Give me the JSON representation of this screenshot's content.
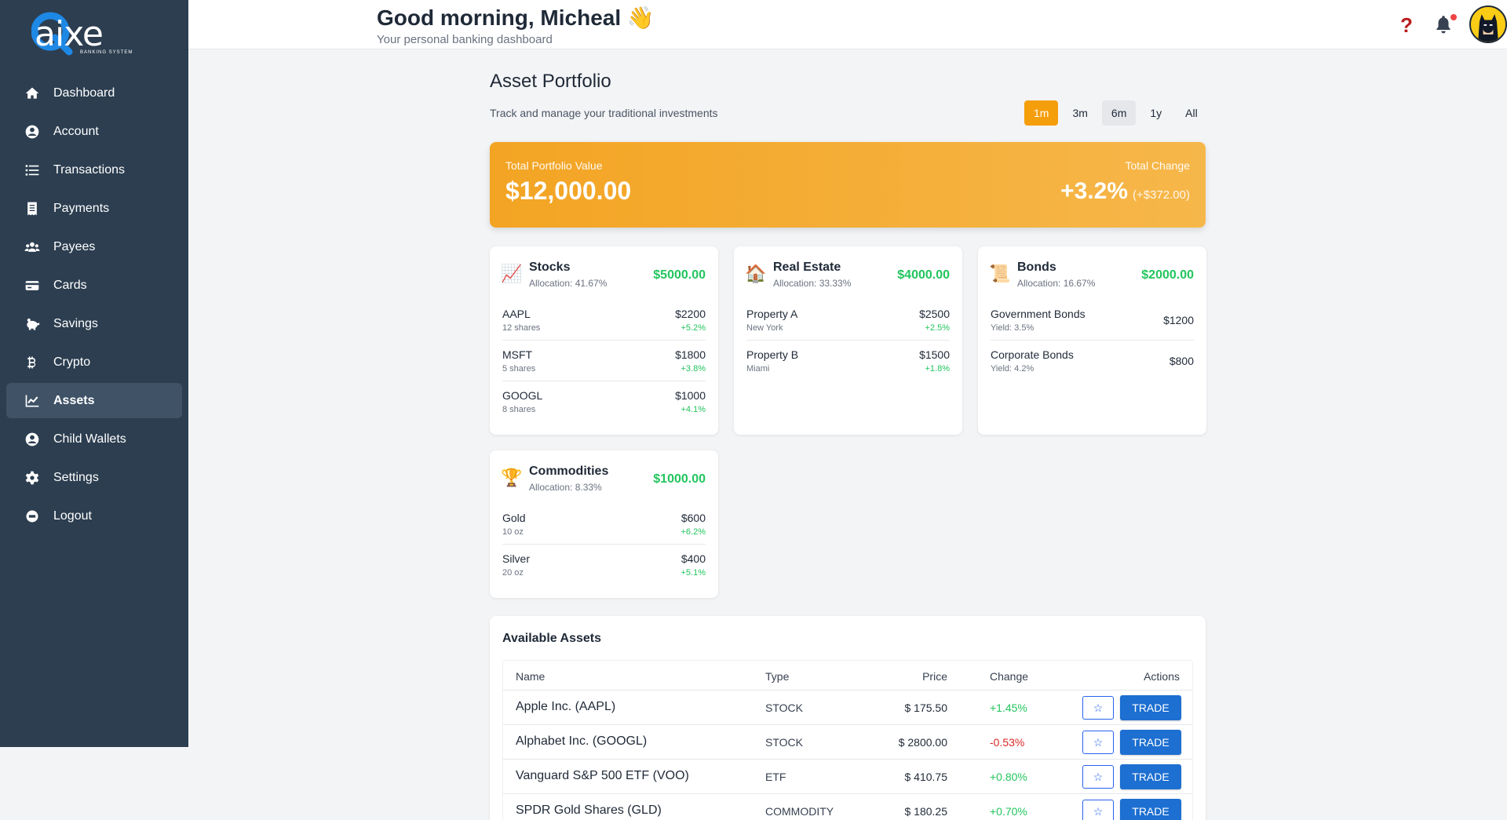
{
  "brand": {
    "logo_text": "aixe",
    "logo_letter": "Q",
    "logo_sub": "BANKING SYSTEM"
  },
  "sidebar": {
    "items": [
      {
        "label": "Dashboard",
        "icon": "home-icon"
      },
      {
        "label": "Account",
        "icon": "user-circle-icon"
      },
      {
        "label": "Transactions",
        "icon": "list-icon"
      },
      {
        "label": "Payments",
        "icon": "receipt-icon"
      },
      {
        "label": "Payees",
        "icon": "users-icon"
      },
      {
        "label": "Cards",
        "icon": "credit-card-icon"
      },
      {
        "label": "Savings",
        "icon": "piggy-bank-icon"
      },
      {
        "label": "Crypto",
        "icon": "bitcoin-icon"
      },
      {
        "label": "Assets",
        "icon": "chart-line-icon",
        "active": true
      },
      {
        "label": "Child Wallets",
        "icon": "user-circle-icon"
      },
      {
        "label": "Settings",
        "icon": "gear-icon"
      },
      {
        "label": "Logout",
        "icon": "logout-icon"
      }
    ]
  },
  "header": {
    "greeting": "Good morning, Micheal",
    "greeting_emoji": "👋",
    "subtitle": "Your personal banking dashboard",
    "help_icon": "question-icon",
    "bell_icon": "bell-icon",
    "avatar": "avatar"
  },
  "main": {
    "title": "Asset Portfolio",
    "subtitle": "Track and manage your traditional investments",
    "ranges": [
      "1m",
      "3m",
      "6m",
      "1y",
      "All"
    ],
    "active_range": "1m",
    "summary": {
      "total_label": "Total Portfolio Value",
      "total_value": "$12,000.00",
      "change_label": "Total Change",
      "change_pct": "+3.2%",
      "change_amt": "(+$372.00)"
    },
    "categories": [
      {
        "title": "Stocks",
        "icon": "📈",
        "allocation": "Allocation: 41.67%",
        "total": "$5000.00",
        "rows": [
          {
            "name": "AAPL",
            "sub": "12 shares",
            "value": "$2200",
            "change": "+5.2%"
          },
          {
            "name": "MSFT",
            "sub": "5 shares",
            "value": "$1800",
            "change": "+3.8%"
          },
          {
            "name": "GOOGL",
            "sub": "8 shares",
            "value": "$1000",
            "change": "+4.1%"
          }
        ]
      },
      {
        "title": "Real Estate",
        "icon": "🏠",
        "allocation": "Allocation: 33.33%",
        "total": "$4000.00",
        "rows": [
          {
            "name": "Property A",
            "sub": "New York",
            "value": "$2500",
            "change": "+2.5%"
          },
          {
            "name": "Property B",
            "sub": "Miami",
            "value": "$1500",
            "change": "+1.8%"
          }
        ]
      },
      {
        "title": "Bonds",
        "icon": "📜",
        "allocation": "Allocation: 16.67%",
        "total": "$2000.00",
        "rows": [
          {
            "name": "Government Bonds",
            "sub": "Yield: 3.5%",
            "value": "$1200",
            "change": ""
          },
          {
            "name": "Corporate Bonds",
            "sub": "Yield: 4.2%",
            "value": "$800",
            "change": ""
          }
        ]
      },
      {
        "title": "Commodities",
        "icon": "🏆",
        "allocation": "Allocation: 8.33%",
        "total": "$1000.00",
        "rows": [
          {
            "name": "Gold",
            "sub": "10 oz",
            "value": "$600",
            "change": "+6.2%"
          },
          {
            "name": "Silver",
            "sub": "20 oz",
            "value": "$400",
            "change": "+5.1%"
          }
        ]
      }
    ],
    "available": {
      "title": "Available Assets",
      "columns": [
        "Name",
        "Type",
        "Price",
        "Change",
        "Actions"
      ],
      "star": "☆",
      "trade_label": "TRADE",
      "rows": [
        {
          "name": "Apple Inc. (AAPL)",
          "type": "STOCK",
          "price": "$ 175.50",
          "change": "+1.45%",
          "dir": "pos"
        },
        {
          "name": "Alphabet Inc. (GOOGL)",
          "type": "STOCK",
          "price": "$ 2800.00",
          "change": "-0.53%",
          "dir": "neg"
        },
        {
          "name": "Vanguard S&P 500 ETF (VOO)",
          "type": "ETF",
          "price": "$ 410.75",
          "change": "+0.80%",
          "dir": "pos"
        },
        {
          "name": "SPDR Gold Shares (GLD)",
          "type": "COMMODITY",
          "price": "$ 180.25",
          "change": "+0.70%",
          "dir": "pos"
        }
      ]
    }
  },
  "colors": {
    "sidebar": "#2c3e50",
    "accent": "#f59e0b",
    "positive": "#22c55e",
    "negative": "#dc2626",
    "trade": "#1d6fd1"
  }
}
